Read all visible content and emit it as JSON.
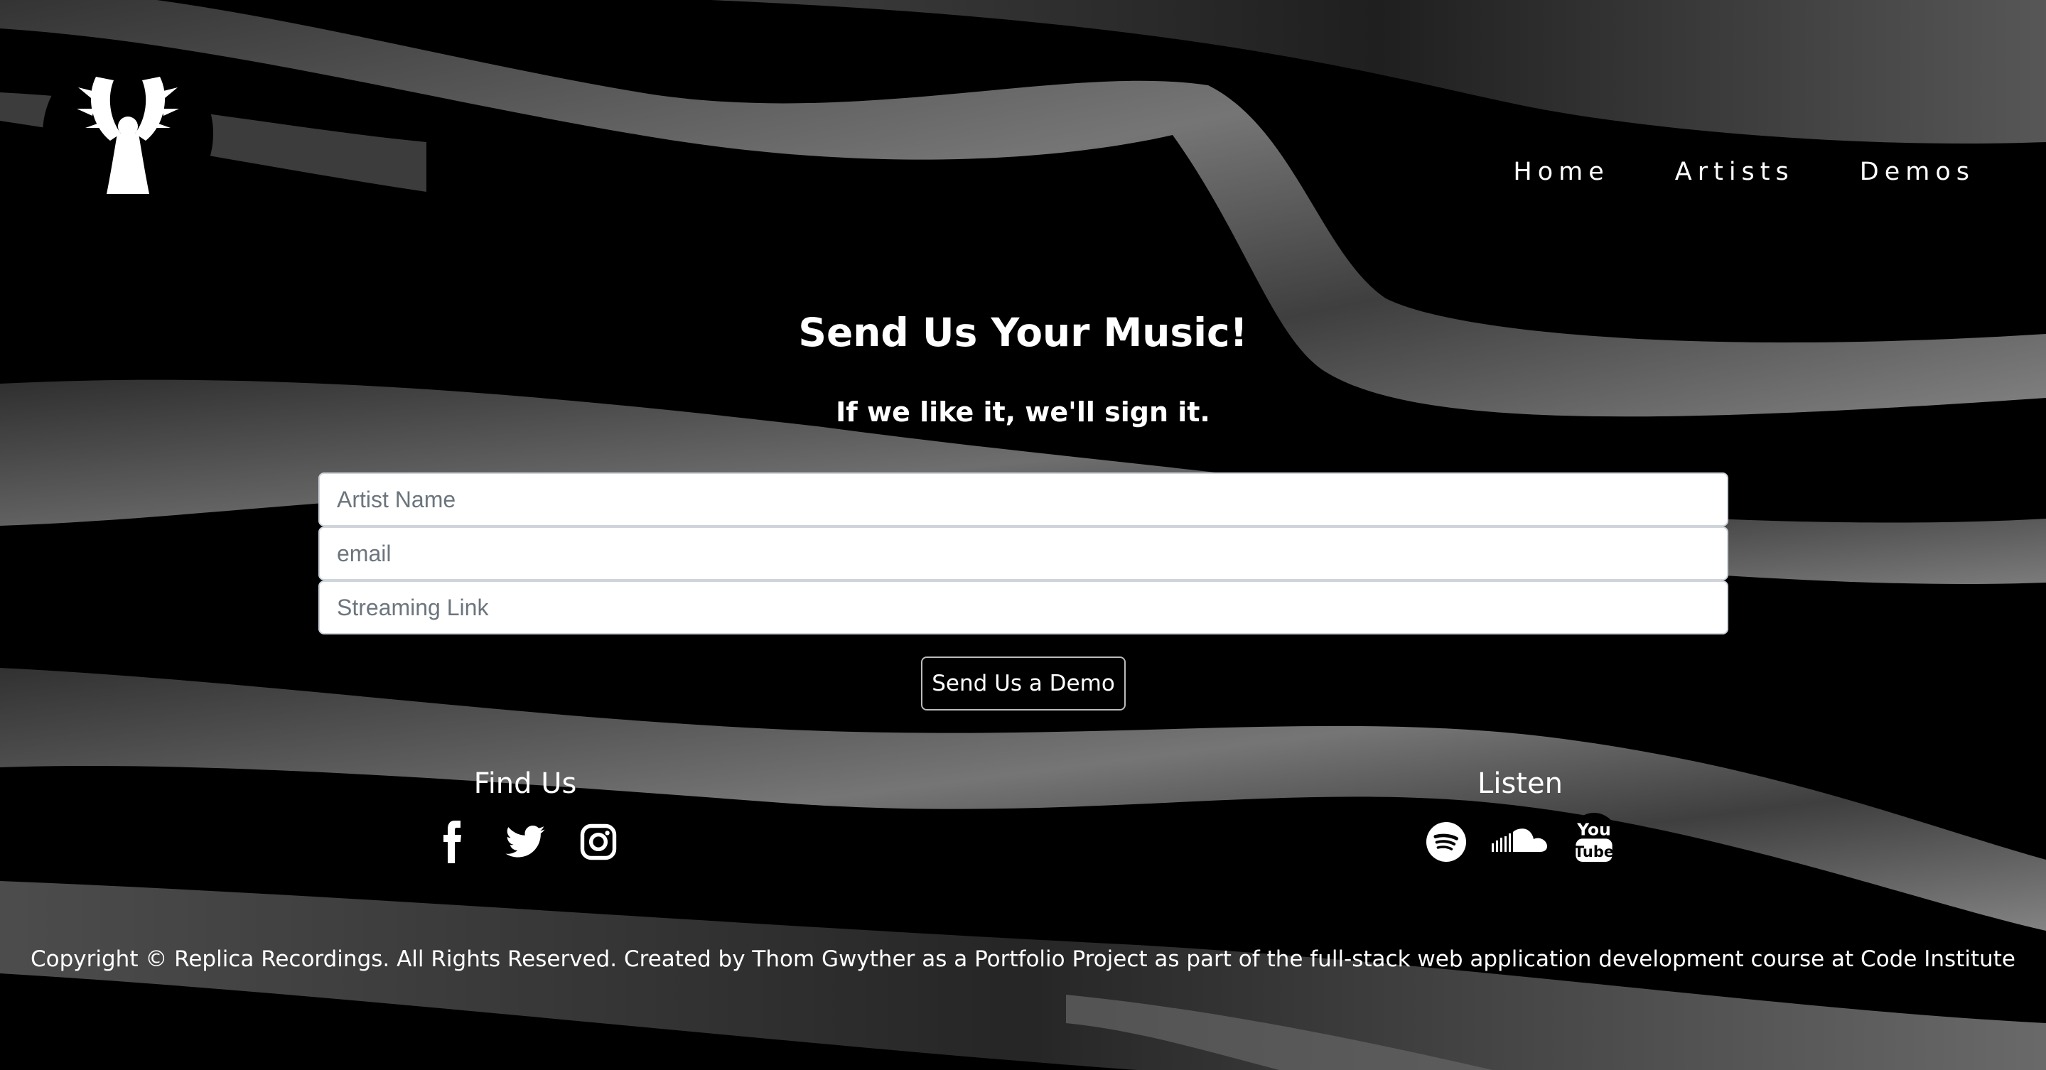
{
  "nav": {
    "items": [
      {
        "label": "Home"
      },
      {
        "label": "Artists"
      },
      {
        "label": "Demos"
      }
    ]
  },
  "main": {
    "heading": "Send Us Your Music!",
    "subheading": "If we like it, we'll sign it.",
    "form": {
      "fields": [
        {
          "placeholder": "Artist Name",
          "value": ""
        },
        {
          "placeholder": "email",
          "value": ""
        },
        {
          "placeholder": "Streaming Link",
          "value": ""
        }
      ],
      "submit_label": "Send Us a Demo"
    }
  },
  "footer": {
    "find_us": {
      "title": "Find Us",
      "icons": [
        "facebook-icon",
        "twitter-icon",
        "instagram-icon"
      ]
    },
    "listen": {
      "title": "Listen",
      "icons": [
        "spotify-icon",
        "soundcloud-icon",
        "youtube-icon"
      ]
    },
    "copyright": "Copyright © Replica Recordings. All Rights Reserved. Created by Thom Gwyther as a Portfolio Project as part of the full-stack web application development course at Code Institute"
  },
  "colors": {
    "background": "#000000",
    "text": "#ffffff",
    "ribbon": "#7a7a7a"
  }
}
